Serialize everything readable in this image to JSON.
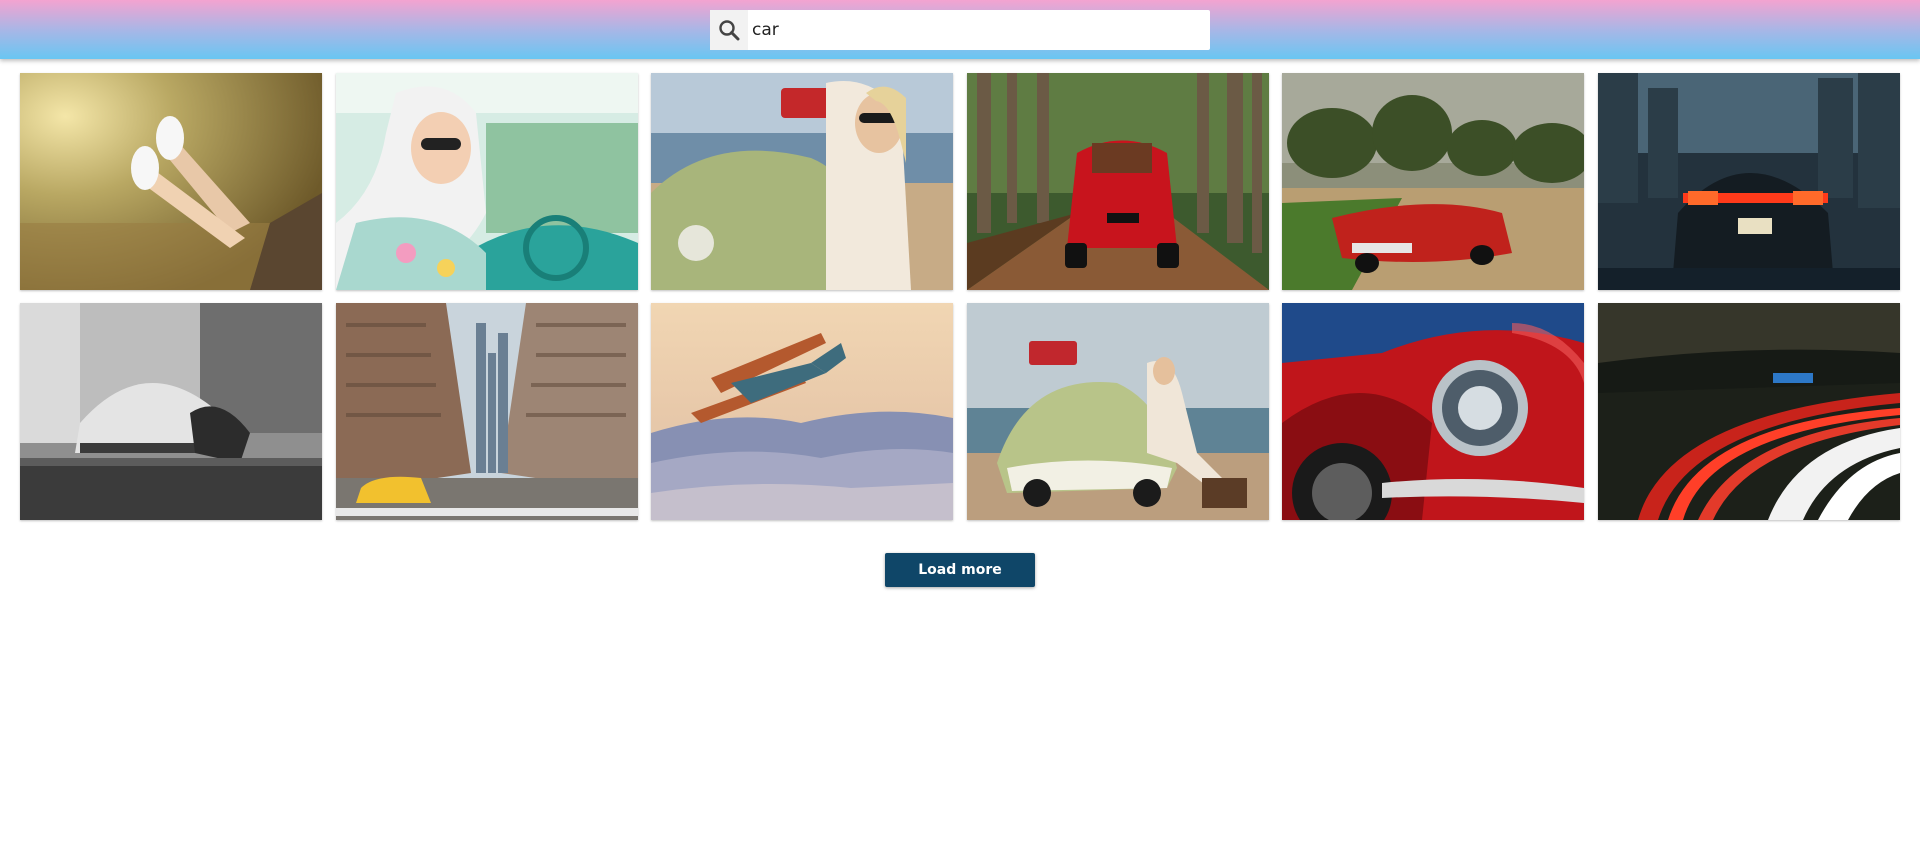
{
  "search": {
    "icon": "search-icon",
    "value": "car"
  },
  "gallery": {
    "images": [
      {
        "subject": "feet-out-of-car-window"
      },
      {
        "subject": "woman-in-headscarf-driving"
      },
      {
        "subject": "woman-with-vw-beetle-beach"
      },
      {
        "subject": "red-fiat-forest-road"
      },
      {
        "subject": "red-classic-convertible"
      },
      {
        "subject": "porsche-taillights-city"
      },
      {
        "subject": "bw-beetle-street"
      },
      {
        "subject": "new-york-street-taxi"
      },
      {
        "subject": "biplane-over-mountains"
      },
      {
        "subject": "green-beetle-beach-woman"
      },
      {
        "subject": "red-car-headlight"
      },
      {
        "subject": "light-trails-highway"
      }
    ]
  },
  "load_more": {
    "label": "Load more"
  },
  "colors": {
    "header_gradient_top": "#f3a3d0",
    "header_gradient_bottom": "#69c6f2",
    "button_bg": "#0f4668"
  }
}
